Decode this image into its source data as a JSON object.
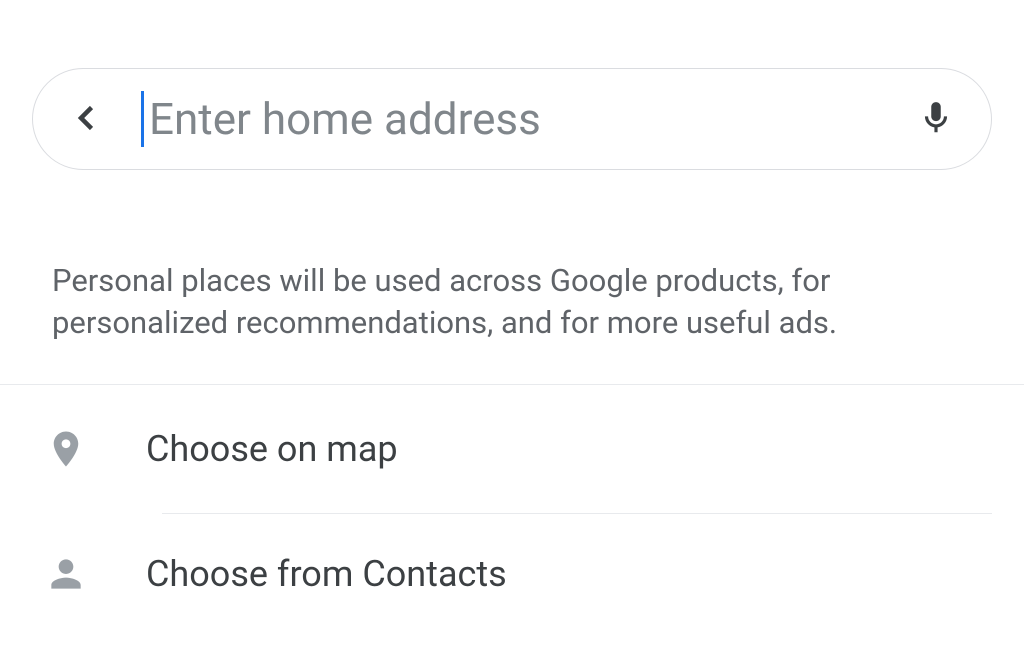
{
  "search": {
    "placeholder": "Enter home address",
    "value": ""
  },
  "info": {
    "text": "Personal places will be used across Google products, for personalized recommendations, and for more useful ads."
  },
  "options": {
    "choose_on_map": "Choose on map",
    "choose_from_contacts": "Choose from Contacts"
  },
  "colors": {
    "accent": "#1a73e8",
    "placeholder": "#80868b",
    "text_secondary": "#5f6368",
    "text_primary": "#3c4043",
    "border": "#dadce0",
    "icon": "#9aa0a6",
    "icon_dark": "#3c4043"
  }
}
